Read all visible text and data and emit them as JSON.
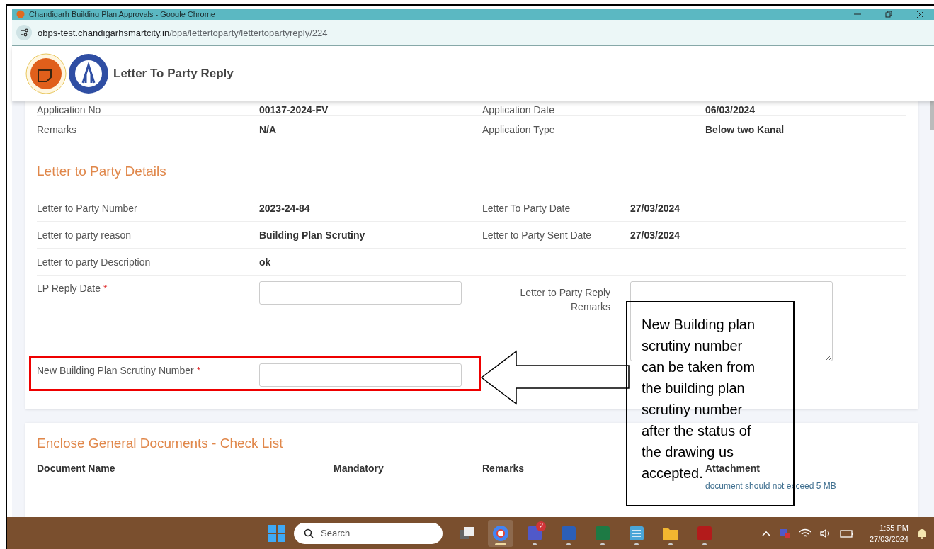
{
  "window": {
    "title": "Chandigarh Building Plan Approvals - Google Chrome"
  },
  "address": {
    "host": "obps-test.chandigarhsmartcity.in",
    "path": "/bpa/lettertoparty/lettertopartyreply/224"
  },
  "header": {
    "title": "Letter To Party Reply"
  },
  "application": {
    "rows": [
      {
        "label": "Application No",
        "value": "00137-2024-FV",
        "label2": "Application Date",
        "value2": "06/03/2024"
      },
      {
        "label": "Remarks",
        "value": "N/A",
        "label2": "Application Type",
        "value2": "Below two Kanal"
      }
    ]
  },
  "details": {
    "heading": "Letter to Party Details",
    "rows": [
      {
        "label": "Letter to Party Number",
        "value": "2023-24-84",
        "label2": "Letter To Party Date",
        "value2": "27/03/2024"
      },
      {
        "label": "Letter to party reason",
        "value": "Building Plan Scrutiny",
        "label2": "Letter to Party Sent Date",
        "value2": "27/03/2024"
      },
      {
        "label": "Letter to party Description",
        "value": "ok"
      }
    ]
  },
  "form": {
    "reply_date": {
      "label": "LP Reply Date",
      "required_mark": "*"
    },
    "reply_remarks": {
      "label": "Letter to Party Reply Remarks"
    },
    "scrutiny_number": {
      "label": "New Building Plan Scrutiny Number",
      "required_mark": "*"
    }
  },
  "documents": {
    "heading": "Enclose General Documents - Check List",
    "columns": [
      "Document Name",
      "Mandatory",
      "Remarks",
      "Attachment"
    ],
    "note": "document should not exceed 5 MB"
  },
  "annotation": {
    "text": "New Building plan scrutiny number can be taken from the building plan scrutiny number after the status of the drawing us accepted."
  },
  "taskbar": {
    "search_placeholder": "Search",
    "apps": [
      {
        "kind": "taskview",
        "running": false,
        "active": false
      },
      {
        "kind": "chrome",
        "running": true,
        "active": true
      },
      {
        "kind": "teams",
        "running": true,
        "active": false,
        "badge": "2"
      },
      {
        "kind": "word",
        "running": true,
        "active": false
      },
      {
        "kind": "excel",
        "running": true,
        "active": false
      },
      {
        "kind": "notepad",
        "running": true,
        "active": false
      },
      {
        "kind": "folder",
        "running": true,
        "active": false
      },
      {
        "kind": "pdf",
        "running": true,
        "active": false
      }
    ],
    "time": "1:55 PM",
    "date": "27/03/2024"
  }
}
